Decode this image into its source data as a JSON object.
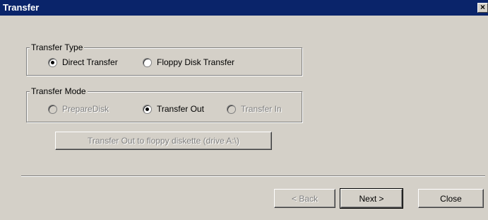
{
  "window": {
    "title": "Transfer",
    "close_glyph": "×"
  },
  "transfer_type": {
    "label": "Transfer Type",
    "options": [
      {
        "label": "Direct Transfer",
        "checked": true,
        "enabled": true
      },
      {
        "label": "Floppy Disk Transfer",
        "checked": false,
        "enabled": true
      }
    ]
  },
  "transfer_mode": {
    "label": "Transfer Mode",
    "options": [
      {
        "label": "PrepareDisk",
        "checked": false,
        "enabled": false
      },
      {
        "label": "Transfer Out",
        "checked": true,
        "enabled": true
      },
      {
        "label": "Transfer In",
        "checked": false,
        "enabled": false
      }
    ]
  },
  "action_button": {
    "label": "Transfer Out to floppy diskette (drive A:\\)",
    "enabled": false
  },
  "footer": {
    "back_label": "< Back",
    "next_label": "Next >",
    "close_label": "Close"
  }
}
